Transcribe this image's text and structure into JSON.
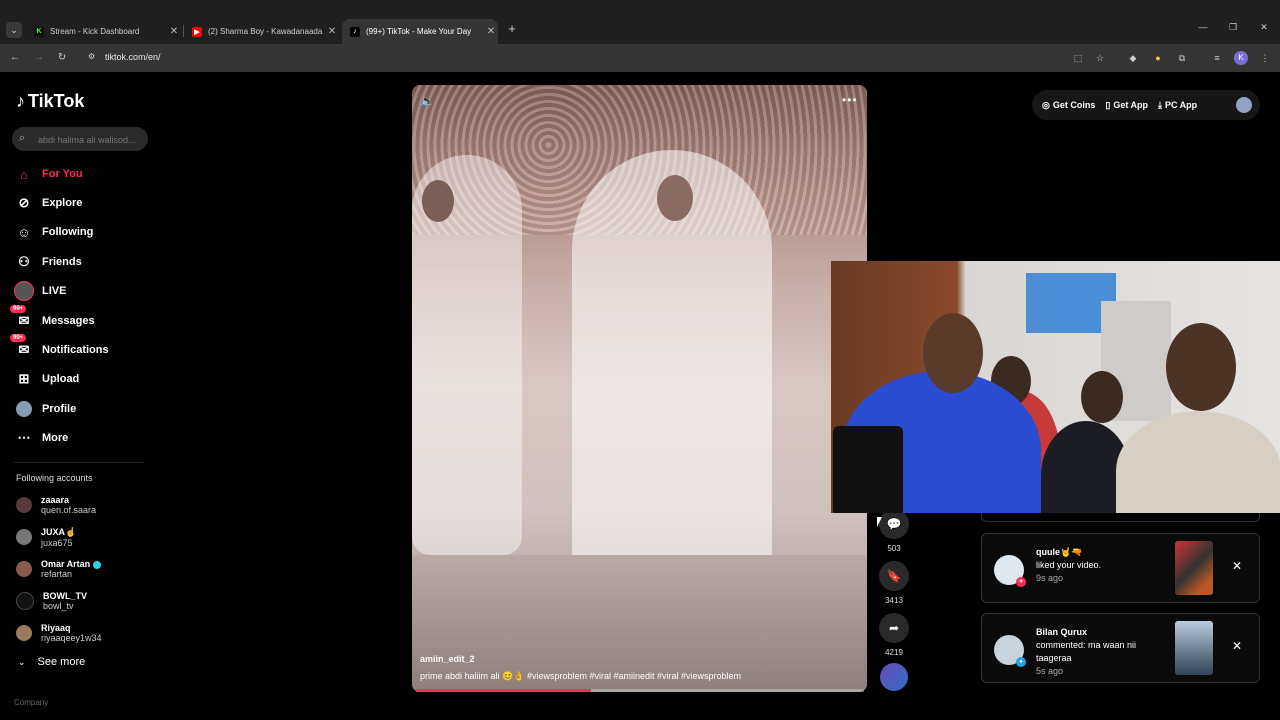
{
  "browser": {
    "tabs": [
      {
        "title": "Stream - Kick Dashboard",
        "icon": "kick-favicon-icon",
        "color": "#53fc18"
      },
      {
        "title": "(2) Sharma Boy - Kawadanaada",
        "icon": "youtube-favicon-icon",
        "color": "#ff0000"
      },
      {
        "title": "(99+) TikTok - Make Your Day",
        "icon": "tiktok-favicon-icon",
        "color": "#ffffff"
      }
    ],
    "url": "tiktok.com/en/"
  },
  "sidebar": {
    "logo": "TikTok",
    "search_placeholder": "abdi halima ali walisod...",
    "nav": [
      {
        "label": "For You",
        "icon": "home-icon"
      },
      {
        "label": "Explore",
        "icon": "compass-icon"
      },
      {
        "label": "Following",
        "icon": "following-user-icon"
      },
      {
        "label": "Friends",
        "icon": "friends-icon"
      },
      {
        "label": "LIVE",
        "icon": "live-icon"
      },
      {
        "label": "Messages",
        "icon": "messages-icon",
        "badge": "99+"
      },
      {
        "label": "Notifications",
        "icon": "notifications-icon",
        "badge": "99+"
      },
      {
        "label": "Upload",
        "icon": "upload-icon"
      },
      {
        "label": "Profile",
        "icon": "profile-avatar-icon"
      },
      {
        "label": "More",
        "icon": "more-dots-icon"
      }
    ],
    "following_title": "Following accounts",
    "accounts": [
      {
        "name": "zaaara",
        "username": "quen.of.saara"
      },
      {
        "name": "JUXA☝",
        "username": "juxa675"
      },
      {
        "name": "Omar Artan",
        "username": "refartan",
        "verified": true
      },
      {
        "name": "BOWL_TV",
        "username": "bowl_tv"
      },
      {
        "name": "Riyaaq",
        "username": "riyaaqeey1w34"
      }
    ],
    "see_more": "See more",
    "company": "Company"
  },
  "video": {
    "author": "amiin_edit_2",
    "caption": "prime abdi haliim ali 😊👌 #viewsproblem  #viral  #amiinedit  #viral  #viewsproblem",
    "progress": 0.39,
    "comments": "503",
    "bookmarks": "3413",
    "shares": "4219"
  },
  "topbar": {
    "get_coins": "Get Coins",
    "get_app": "Get App",
    "pc_app": "PC App"
  },
  "notifications": [
    {
      "user": "quule🤘🔫",
      "action": "liked your video.",
      "time": "9s ago"
    },
    {
      "user": "Bilan Qurux",
      "action": "commented: ma waan nii taageraa",
      "time": "5s ago"
    }
  ],
  "colors": {
    "accent": "#fe2c55",
    "verified": "#20d5ec"
  }
}
